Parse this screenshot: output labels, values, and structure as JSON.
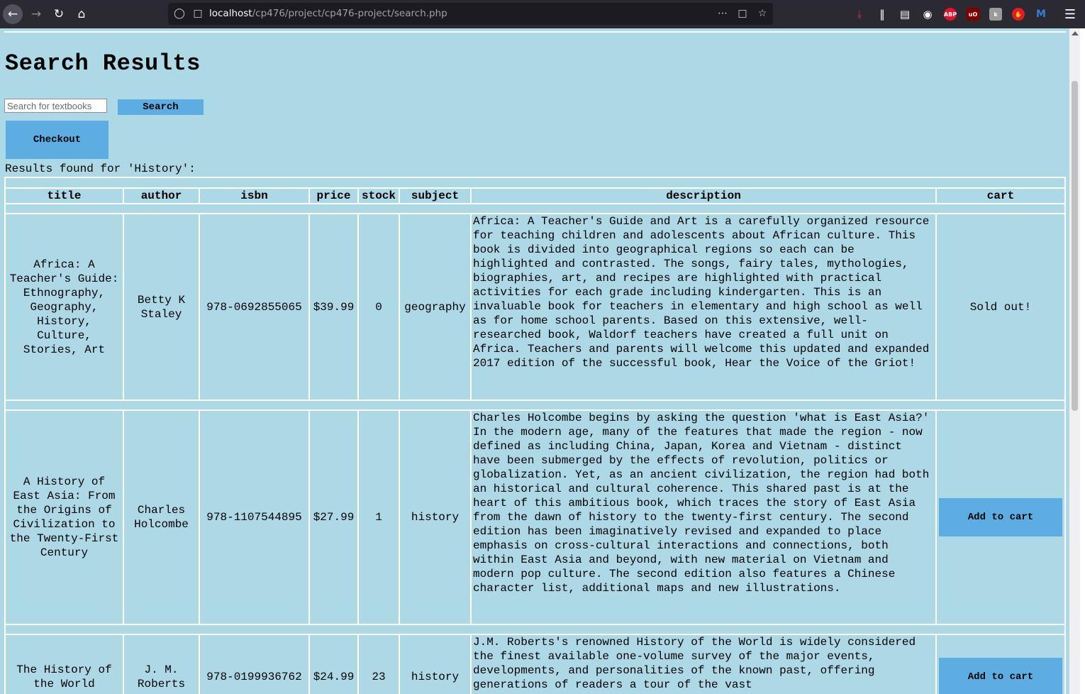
{
  "browser": {
    "url_prefix": "localhost",
    "url_path": "/cp476/project/cp476-project/search.php"
  },
  "page": {
    "title": "Search Results",
    "search": {
      "placeholder": "Search for textbooks",
      "button_label": "Search"
    },
    "checkout_label": "Checkout",
    "results_label": "Results found for 'History':"
  },
  "table": {
    "headers": [
      "title",
      "author",
      "isbn",
      "price",
      "stock",
      "subject",
      "description",
      "cart"
    ],
    "rows": [
      {
        "title": "Africa: A Teacher's Guide: Ethnography, Geography, History, Culture, Stories, Art",
        "author": "Betty K Staley",
        "isbn": "978-0692855065",
        "price": "$39.99",
        "stock": "0",
        "subject": "geography",
        "description": "Africa: A Teacher's Guide and Art is a carefully organized resource for teaching children and adolescents about African culture. This book is divided into geographical regions so each can be highlighted and contrasted. The songs, fairy tales, mythologies, biographies, art, and recipes are highlighted with practical activities for each grade including kindergarten. This is an invaluable book for teachers in elementary and high school as well as for home school parents. Based on this extensive, well-researched book, Waldorf teachers have created a full unit on Africa. Teachers and parents will welcome this updated and expanded 2017 edition of the successful book, Hear the Voice of the Griot!",
        "cart": "Sold out!"
      },
      {
        "title": "A History of East Asia: From the Origins of Civilization to the Twenty-First Century",
        "author": "Charles Holcombe",
        "isbn": "978-1107544895",
        "price": "$27.99",
        "stock": "1",
        "subject": "history",
        "description": "Charles Holcombe begins by asking the question 'what is East Asia?' In the modern age, many of the features that made the region - now defined as including China, Japan, Korea and Vietnam - distinct have been submerged by the effects of revolution, politics or globalization. Yet, as an ancient civilization, the region had both an historical and cultural coherence. This shared past is at the heart of this ambitious book, which traces the story of East Asia from the dawn of history to the twenty-first century. The second edition has been imaginatively revised and expanded to place emphasis on cross-cultural interactions and connections, both within East Asia and beyond, with new material on Vietnam and modern pop culture. The second edition also features a Chinese character list, additional maps and new illustrations.",
        "cart": "Add to cart"
      },
      {
        "title": "The History of the World",
        "author": "J. M. Roberts",
        "isbn": "978-0199936762",
        "price": "$24.99",
        "stock": "23",
        "subject": "history",
        "description": "J.M. Roberts's renowned History of the World is widely considered the finest available one-volume survey of the major events, developments, and personalities of the known past, offering generations of readers a tour of the vast",
        "cart": "Add to cart"
      }
    ]
  }
}
